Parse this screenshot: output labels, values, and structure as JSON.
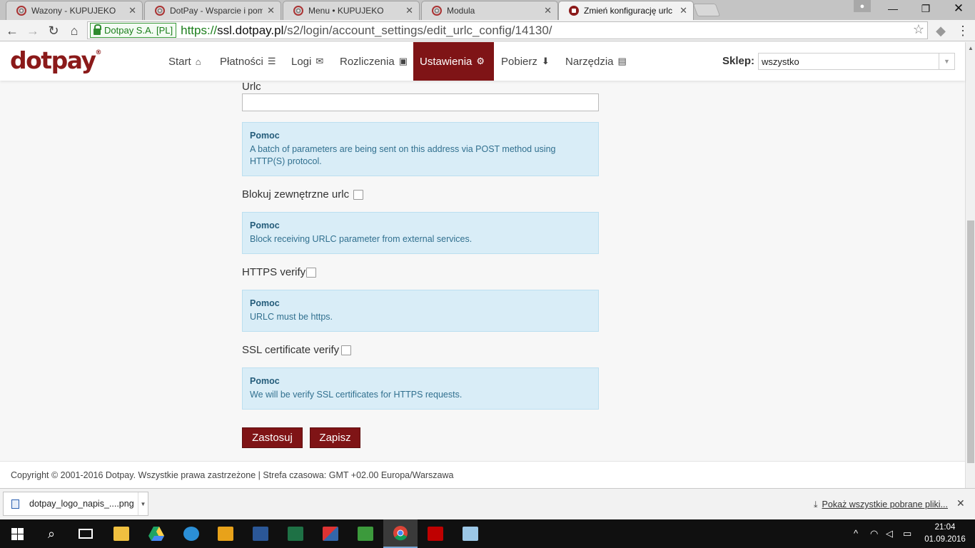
{
  "browser": {
    "tabs": [
      {
        "title": "Wazony - KUPUJEKO",
        "active": false
      },
      {
        "title": "DotPay - Wsparcie i pomo",
        "active": false
      },
      {
        "title": "Menu • KUPUJEKO",
        "active": false
      },
      {
        "title": "Modula",
        "active": false
      },
      {
        "title": "Zmień konfigurację urlc",
        "active": true
      }
    ],
    "ev_badge": "Dotpay S.A. [PL]",
    "url_scheme": "https://",
    "url_host": "ssl.dotpay.pl",
    "url_path": "/s2/login/account_settings/edit_urlc_config/14130/"
  },
  "site": {
    "logo": "dotpay",
    "logo_mark": "®",
    "menu": [
      {
        "label": "Start",
        "icon": "home-icon",
        "glyph": "⌂"
      },
      {
        "label": "Płatności",
        "icon": "list-icon",
        "glyph": "☰"
      },
      {
        "label": "Logi",
        "icon": "envelope-icon",
        "glyph": "✉"
      },
      {
        "label": "Rozliczenia",
        "icon": "money-icon",
        "glyph": "▣"
      },
      {
        "label": "Ustawienia",
        "icon": "cogs-icon",
        "glyph": "⚙"
      },
      {
        "label": "Pobierz",
        "icon": "download-icon",
        "glyph": "⬇"
      },
      {
        "label": "Narzędzia",
        "icon": "briefcase-icon",
        "glyph": "▤"
      }
    ],
    "active_menu": "Ustawienia",
    "shop_label": "Sklep:",
    "shop_value": "wszystko"
  },
  "form": {
    "urlc_label": "Urlc",
    "urlc_value": "",
    "help_title": "Pomoc",
    "help_urlc": "A batch of parameters are being sent on this address via POST method using HTTP(S) protocol.",
    "block_label": "Blokuj zewnętrzne urlc",
    "block_checked": false,
    "help_block": "Block receiving URLC parameter from external services.",
    "https_label": "HTTPS verify",
    "https_checked": false,
    "help_https": "URLC must be https.",
    "ssl_label": "SSL certificate verify",
    "ssl_checked": false,
    "help_ssl": "We will be verify SSL certificates for HTTPS requests.",
    "apply_button": "Zastosuj",
    "save_button": "Zapisz"
  },
  "footer": {
    "text": "Copyright © 2001-2016 Dotpay. Wszystkie prawa zastrzeżone | Strefa czasowa: GMT +02.00 Europa/Warszawa"
  },
  "downloads": {
    "file": "dotpay_logo_napis_....png",
    "show_all": "Pokaż wszystkie pobrane pliki..."
  },
  "taskbar": {
    "time": "21:04",
    "date": "01.09.2016"
  },
  "colors": {
    "brand": "#7f1416",
    "help_bg": "#d9edf7",
    "secure_green": "#1b7e1b"
  }
}
